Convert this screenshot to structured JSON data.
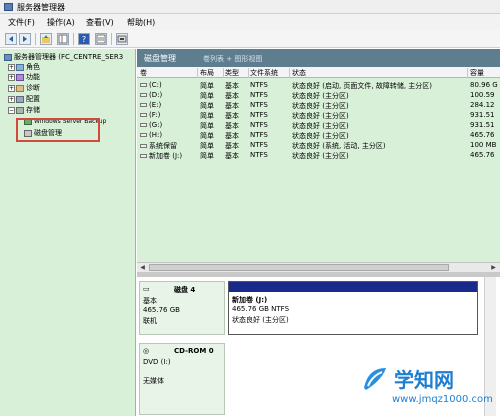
{
  "window": {
    "title": "服务器管理器"
  },
  "menu": [
    "文件(F)",
    "操作(A)",
    "查看(V)",
    "帮助(H)"
  ],
  "toolbar": [
    "back-icon",
    "forward-icon",
    "up-folder-icon",
    "show-tree-icon",
    "help-icon",
    "properties-icon",
    "console-icon"
  ],
  "tree": {
    "root": "服务器管理器 (FC_CENTRE_SER3",
    "roles": "角色",
    "features": "功能",
    "diagnostics": "诊断",
    "config": "配置",
    "storage": "存储",
    "backup": "Windows Server Backup",
    "disk_mgmt": "磁盘管理"
  },
  "pane": {
    "title": "磁盘管理",
    "subtitle": "卷列表 + 图形视图"
  },
  "volumes": {
    "headers": [
      "卷",
      "布局",
      "类型",
      "文件系统",
      "状态",
      "容量"
    ],
    "rows": [
      [
        "(C:)",
        "简单",
        "基本",
        "NTFS",
        "状态良好 (启动, 页面文件, 故障转储, 主分区)",
        "80.96 G"
      ],
      [
        "(D:)",
        "简单",
        "基本",
        "NTFS",
        "状态良好 (主分区)",
        "100.59"
      ],
      [
        "(E:)",
        "简单",
        "基本",
        "NTFS",
        "状态良好 (主分区)",
        "284.12"
      ],
      [
        "(F:)",
        "简单",
        "基本",
        "NTFS",
        "状态良好 (主分区)",
        "931.51"
      ],
      [
        "(G:)",
        "简单",
        "基本",
        "NTFS",
        "状态良好 (主分区)",
        "931.51"
      ],
      [
        "(H:)",
        "简单",
        "基本",
        "NTFS",
        "状态良好 (主分区)",
        "465.76"
      ],
      [
        "系统保留",
        "简单",
        "基本",
        "NTFS",
        "状态良好 (系统, 活动, 主分区)",
        "100 MB"
      ],
      [
        "新加卷 (J:)",
        "简单",
        "基本",
        "NTFS",
        "状态良好 (主分区)",
        "465.76"
      ]
    ]
  },
  "disks": [
    {
      "name": "磁盘 4",
      "type": "基本",
      "size": "465.76 GB",
      "status": "联机",
      "volume": {
        "name": "新加卷 (J:)",
        "size": "465.76 GB NTFS",
        "status": "状态良好 (主分区)"
      }
    },
    {
      "name": "CD-ROM 0",
      "type": "DVD (I:)",
      "status": "无媒体"
    }
  ],
  "watermark": {
    "title": "学知网",
    "url": "www.jmqz1000.com"
  },
  "colors": {
    "pane_header": "#5e7d8f",
    "tree_bg": "#d8f0d8",
    "volume_bar": "#1a2a8a",
    "highlight": "#d24a3c",
    "watermark": "#1e7fd0"
  }
}
